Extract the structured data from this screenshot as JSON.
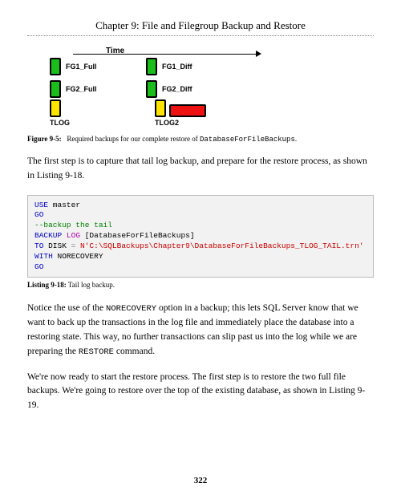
{
  "header": {
    "chapter_title": "Chapter 9: File and Filegroup Backup and Restore"
  },
  "diagram": {
    "time_label": "Time",
    "fg1_full": "FG1_Full",
    "fg1_diff": "FG1_Diff",
    "fg2_full": "FG2_Full",
    "fg2_diff": "FG2_Diff",
    "tlog": "TLOG",
    "tlog2": "TLOG2"
  },
  "figure_caption": {
    "number": "Figure 9-5:",
    "text_before": "Required backups for our complete restore of ",
    "db_name": "DatabaseForFileBackups",
    "text_after": "."
  },
  "para1": "The first step is to capture that tail log backup, and prepare for the restore process, as shown in Listing 9-18.",
  "code": {
    "line1a": "USE",
    "line1b": " master",
    "line2": "GO",
    "line3": "--backup the tail",
    "line4a": "BACKUP",
    "line4b": " LOG ",
    "line4c": "[DatabaseForFileBackups]",
    "line5a": "TO",
    "line5b": " DISK ",
    "line5c": "=",
    "line5d": " N'C:\\SQLBackups\\Chapter9\\DatabaseForFileBackups_TLOG_TAIL.trn'",
    "line6a": "WITH",
    "line6b": " NORECOVERY",
    "line7": "GO"
  },
  "listing_caption": {
    "number": "Listing 9-18:",
    "text": "Tail log backup."
  },
  "para2_a": "Notice the use of the ",
  "para2_b": "NORECOVERY",
  "para2_c": " option in a backup; this lets SQL Server know that we want to back up the transactions in the log file and immediately place the database into a restoring state. This way, no further transactions can slip past us into the log while we are preparing the ",
  "para2_d": "RESTORE",
  "para2_e": " command.",
  "para3": "We're now ready to start the restore process. The first step is to restore the two full file backups. We're going to restore over the top of the existing database, as shown in Listing 9-19.",
  "page_number": "322"
}
